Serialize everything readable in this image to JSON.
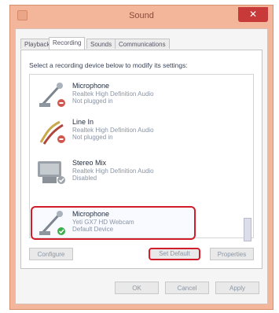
{
  "window": {
    "title": "Sound"
  },
  "tabs": [
    {
      "label": "Playback"
    },
    {
      "label": "Recording"
    },
    {
      "label": "Sounds"
    },
    {
      "label": "Communications"
    }
  ],
  "instruction": "Select a recording device below to modify its settings:",
  "devices": [
    {
      "name": "Microphone",
      "line1": "Realtek High Definition Audio",
      "line2": "Not plugged in",
      "icon": "microphone-icon"
    },
    {
      "name": "Line In",
      "line1": "Realtek High Definition Audio",
      "line2": "Not plugged in",
      "icon": "line-in-icon"
    },
    {
      "name": "Stereo Mix",
      "line1": "Realtek High Definition Audio",
      "line2": "Disabled",
      "icon": "stereo-mix-icon"
    },
    {
      "name": "Microphone",
      "line1": "Yeti GX7 HD Webcam",
      "line2": "Default Device",
      "icon": "microphone-icon"
    }
  ],
  "buttons": {
    "configure": "Configure",
    "set_default": "Set Default",
    "properties": "Properties",
    "ok": "OK",
    "cancel": "Cancel",
    "apply": "Apply"
  },
  "colors": {
    "selection_outline": "#d11d2a",
    "titlebar": "#f3b69a",
    "close": "#c8393a"
  }
}
